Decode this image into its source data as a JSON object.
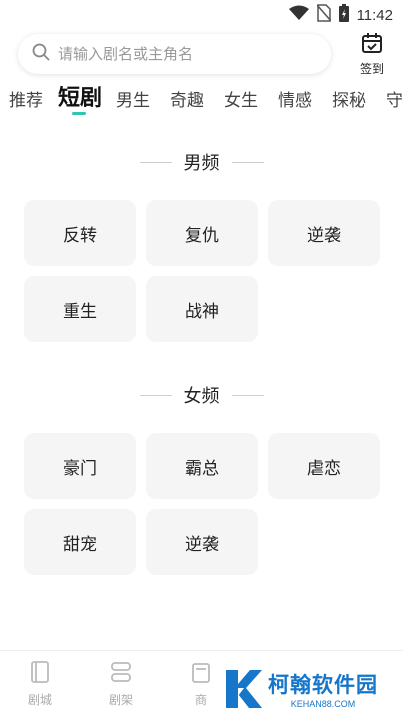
{
  "status_bar": {
    "time": "11:42",
    "icons": [
      "wifi-icon",
      "no-sim-icon",
      "battery-charging-icon"
    ]
  },
  "search": {
    "placeholder": "请输入剧名或主角名"
  },
  "checkin": {
    "label": "签到"
  },
  "tabs": [
    {
      "label": "推荐",
      "active": false
    },
    {
      "label": "短剧",
      "active": true
    },
    {
      "label": "男生",
      "active": false
    },
    {
      "label": "奇趣",
      "active": false
    },
    {
      "label": "女生",
      "active": false
    },
    {
      "label": "情感",
      "active": false
    },
    {
      "label": "探秘",
      "active": false
    },
    {
      "label": "守",
      "active": false
    }
  ],
  "sections": [
    {
      "title": "男频",
      "items": [
        "反转",
        "复仇",
        "逆袭",
        "重生",
        "战神"
      ]
    },
    {
      "title": "女频",
      "items": [
        "豪门",
        "霸总",
        "虐恋",
        "甜宠",
        "逆袭"
      ]
    }
  ],
  "bottom_nav": [
    {
      "label": "剧城",
      "icon": "book-icon"
    },
    {
      "label": "剧架",
      "icon": "shelf-icon"
    },
    {
      "label": "商",
      "icon": "store-icon"
    }
  ],
  "watermark": {
    "main": "柯翰软件园",
    "sub": "KEHAN88.COM"
  },
  "colors": {
    "accent": "#2fc6b0",
    "watermark": "#1676c9"
  }
}
